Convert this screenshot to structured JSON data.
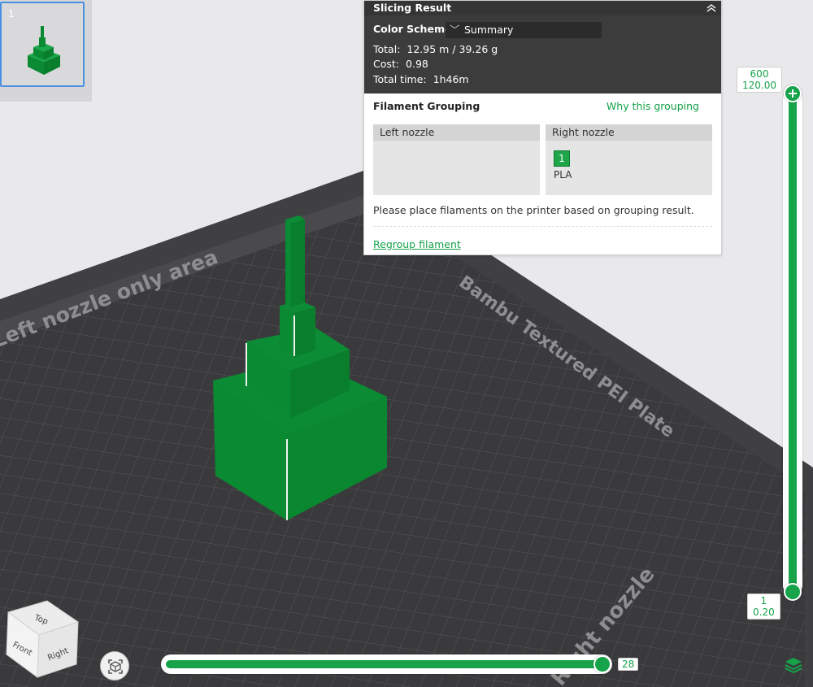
{
  "plate": {
    "number": "1"
  },
  "slicing_result": {
    "title": "Slicing Result",
    "color_scheme_label": "Color Scheme",
    "color_scheme_value": "Summary",
    "total_label": "Total:",
    "total_value": "12.95 m / 39.26 g",
    "cost_label": "Cost:",
    "cost_value": "0.98",
    "time_label": "Total time:",
    "time_value": "1h46m"
  },
  "filament_grouping": {
    "title": "Filament Grouping",
    "why_link": "Why this grouping",
    "left_nozzle": "Left nozzle",
    "right_nozzle": "Right nozzle",
    "filament_id": "1",
    "filament_type": "PLA",
    "filament_color": "#1fa64a",
    "message": "Please place filaments on the printer based on grouping result.",
    "regroup_link": "Regroup filament"
  },
  "plate_labels": {
    "left_area": "Left nozzle only area",
    "plate_name": "Bambu Textured PEI Plate",
    "right_area": "Right nozzle"
  },
  "layer_slider": {
    "top_layer": "600",
    "top_height": "120.00",
    "bottom_layer": "1",
    "bottom_height": "0.20"
  },
  "move_slider": {
    "value": "28"
  },
  "view_cube": {
    "top": "Top",
    "front": "Front",
    "right": "Right"
  },
  "colors": {
    "accent": "#16a34a",
    "model": "#0a8a32",
    "bed": "#3a3a3c"
  }
}
